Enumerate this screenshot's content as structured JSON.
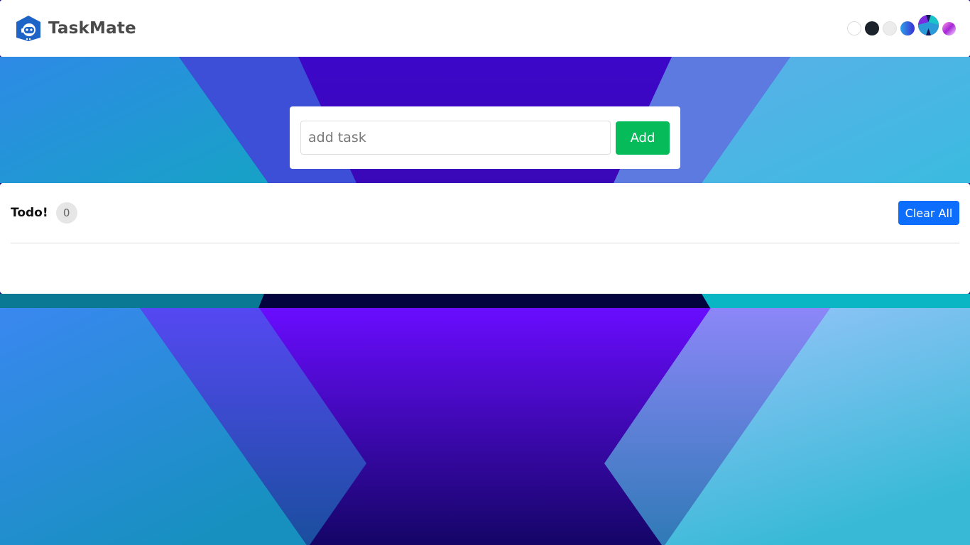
{
  "app": {
    "name": "TaskMate",
    "logo_icon": "robot-house-icon"
  },
  "themes": {
    "options": [
      "white",
      "dark",
      "light-gray",
      "blue-gradient",
      "aurora",
      "pink-gradient"
    ]
  },
  "add_task": {
    "placeholder": "add task",
    "value": "",
    "button_label": "Add"
  },
  "todo": {
    "title": "Todo!",
    "count": "0",
    "clear_label": "Clear All",
    "items": []
  },
  "colors": {
    "add_button": "#06bb5a",
    "clear_button": "#0d6efd",
    "logo": "#1e63c6"
  }
}
